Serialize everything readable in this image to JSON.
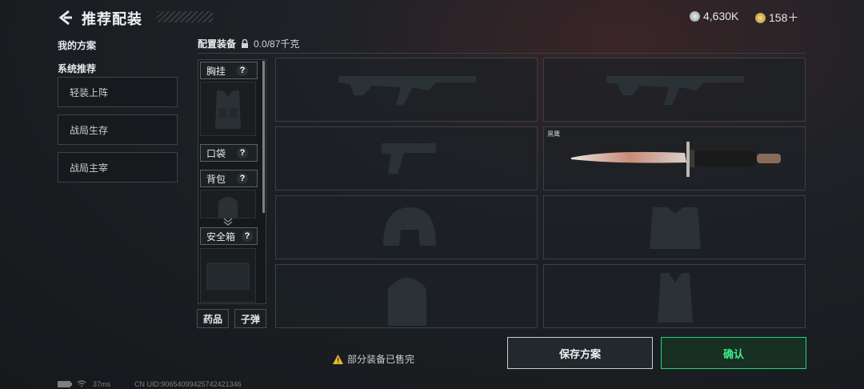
{
  "header": {
    "title": "推荐配装",
    "currency_a": "4,630K",
    "currency_b": "158＋"
  },
  "left": {
    "my_plans": "我的方案",
    "system_recommend": "系统推荐",
    "presets": [
      "轻装上阵",
      "战局生存",
      "战局主宰"
    ]
  },
  "loadout": {
    "title": "配置装备",
    "weight": "0.0/87千克"
  },
  "slots": {
    "chest_rig": "胸挂",
    "pocket": "口袋",
    "backpack": "背包",
    "safe_box": "安全箱",
    "help": "?",
    "meds": "药品",
    "ammo": "子弹"
  },
  "grid": {
    "knife_name": "黑鹰"
  },
  "footer": {
    "warning": "部分装备已售完",
    "save": "保存方案",
    "confirm": "确认"
  },
  "status": {
    "ping": "37ms",
    "uid": "CN UID:9065409942574242​1346"
  },
  "colors": {
    "accent": "#3ef08e",
    "warning": "#e8b92a"
  }
}
